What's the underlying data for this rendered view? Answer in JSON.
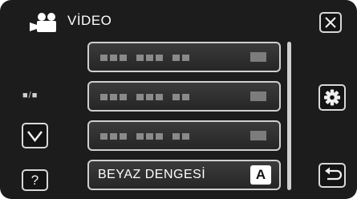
{
  "header": {
    "icon": "video-camera-icon",
    "title": "VİDEO"
  },
  "navigation": {
    "page_indicator": "■/■",
    "close_icon": "close-x-icon",
    "settings_icon": "gear-icon",
    "down_icon": "chevron-down-icon",
    "help_label": "?",
    "back_icon": "return-arrow-icon"
  },
  "menu": {
    "items": [
      {
        "label": "",
        "value": ""
      },
      {
        "label": "",
        "value": ""
      },
      {
        "label": "",
        "value": ""
      },
      {
        "label": "BEYAZ DENGESİ",
        "value": "A"
      }
    ]
  },
  "colors": {
    "background": "#1c1c1c",
    "button_border": "#d8d8d8",
    "text": "#ffffff"
  }
}
